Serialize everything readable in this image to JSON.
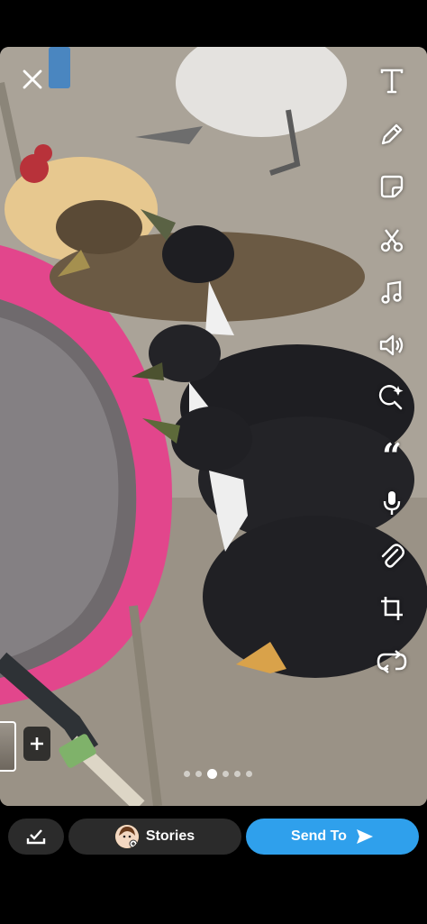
{
  "photo": {
    "description_icon": "photo-of-ducks-drinking"
  },
  "top": {
    "close_icon": "close-icon"
  },
  "toolbar": {
    "items": [
      {
        "name": "text-tool",
        "icon": "text-icon"
      },
      {
        "name": "draw-tool",
        "icon": "pencil-icon"
      },
      {
        "name": "sticker-tool",
        "icon": "sticker-icon"
      },
      {
        "name": "scissors-tool",
        "icon": "scissors-icon"
      },
      {
        "name": "music-tool",
        "icon": "music-note-icon"
      },
      {
        "name": "sound-tool",
        "icon": "speaker-icon"
      },
      {
        "name": "lens-tool",
        "icon": "sparkle-search-icon"
      },
      {
        "name": "caption-tool",
        "icon": "quote-icon"
      },
      {
        "name": "voice-tool",
        "icon": "microphone-icon"
      },
      {
        "name": "attach-tool",
        "icon": "paperclip-icon"
      },
      {
        "name": "crop-tool",
        "icon": "crop-icon"
      },
      {
        "name": "loop-tool",
        "icon": "loop-icon"
      }
    ]
  },
  "pager": {
    "count": 6,
    "active_index": 2
  },
  "bottom": {
    "stories_label": "Stories",
    "send_label": "Send To",
    "accent_color": "#2fa0ec"
  }
}
